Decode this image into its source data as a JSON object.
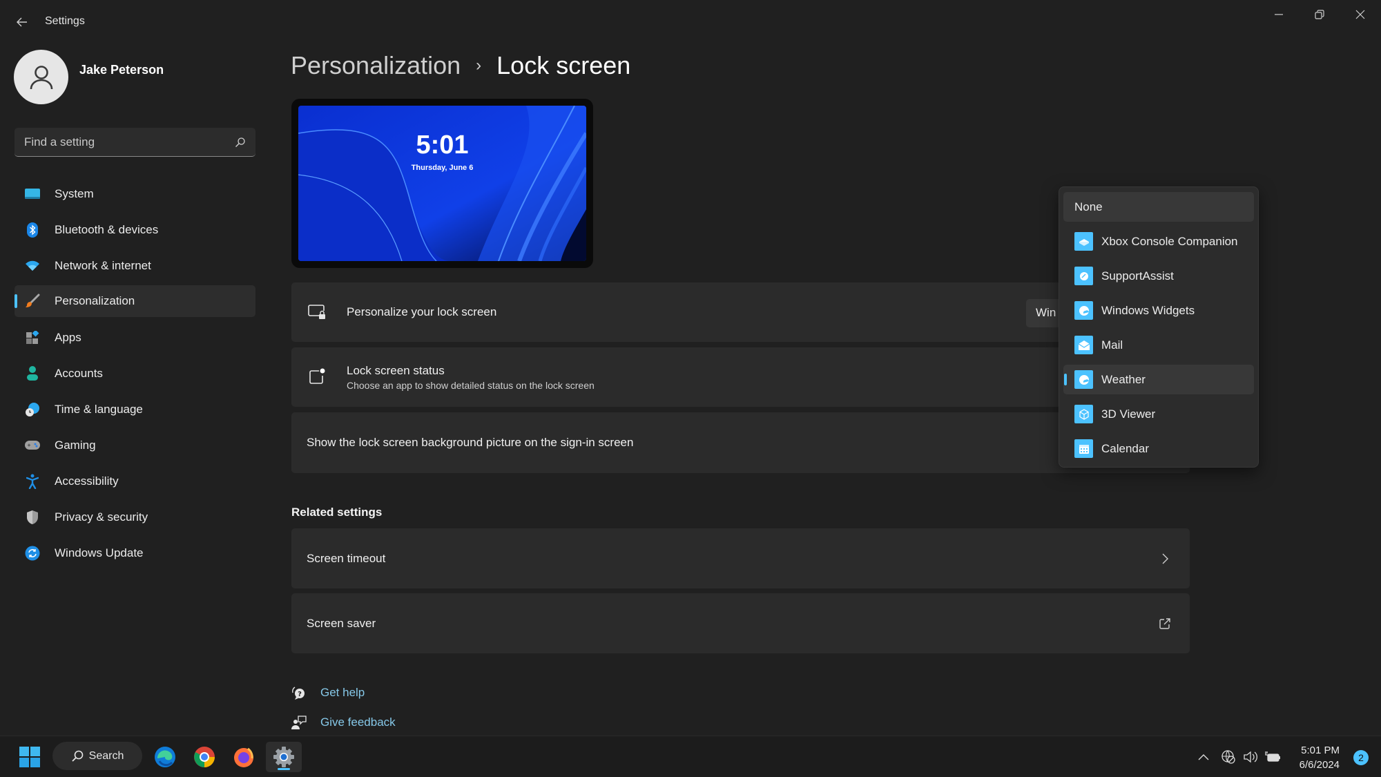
{
  "window": {
    "title": "Settings",
    "controls": [
      "minimize",
      "restore",
      "close"
    ]
  },
  "profile": {
    "name": "Jake Peterson"
  },
  "search": {
    "placeholder": "Find a setting",
    "value": ""
  },
  "sidebar": {
    "selected": "Personalization",
    "items": [
      {
        "label": "System",
        "icon": "monitor-icon"
      },
      {
        "label": "Bluetooth & devices",
        "icon": "bluetooth-icon"
      },
      {
        "label": "Network & internet",
        "icon": "wifi-icon"
      },
      {
        "label": "Personalization",
        "icon": "paintbrush-icon"
      },
      {
        "label": "Apps",
        "icon": "apps-icon"
      },
      {
        "label": "Accounts",
        "icon": "person-icon"
      },
      {
        "label": "Time & language",
        "icon": "globe-clock-icon"
      },
      {
        "label": "Gaming",
        "icon": "gamepad-icon"
      },
      {
        "label": "Accessibility",
        "icon": "accessibility-icon"
      },
      {
        "label": "Privacy & security",
        "icon": "shield-icon"
      },
      {
        "label": "Windows Update",
        "icon": "update-icon"
      }
    ]
  },
  "breadcrumb": {
    "parent": "Personalization",
    "separator": "›",
    "current": "Lock screen"
  },
  "preview": {
    "time": "5:01",
    "date": "Thursday, June 6"
  },
  "cards": {
    "personalize": {
      "title": "Personalize your lock screen",
      "value_truncated": "Win"
    },
    "status": {
      "title": "Lock screen status",
      "subtitle": "Choose an app to show detailed status on the lock screen"
    },
    "signin": {
      "title": "Show the lock screen background picture on the sign-in screen"
    }
  },
  "related": {
    "heading": "Related settings",
    "items": [
      {
        "label": "Screen timeout",
        "icon": "chevron-right-icon"
      },
      {
        "label": "Screen saver",
        "icon": "open-external-icon"
      }
    ]
  },
  "help": {
    "get_help": "Get help",
    "give_feedback": "Give feedback"
  },
  "dropdown": {
    "hovered": "None",
    "selected": "Weather",
    "options": [
      {
        "label": "None",
        "icon": null
      },
      {
        "label": "Xbox Console Companion",
        "icon": "xbox-console-icon"
      },
      {
        "label": "SupportAssist",
        "icon": "supportassist-icon"
      },
      {
        "label": "Windows Widgets",
        "icon": "widgets-icon"
      },
      {
        "label": "Mail",
        "icon": "mail-icon"
      },
      {
        "label": "Weather",
        "icon": "weather-icon"
      },
      {
        "label": "3D Viewer",
        "icon": "cube-icon"
      },
      {
        "label": "Calendar",
        "icon": "calendar-icon"
      }
    ]
  },
  "taskbar": {
    "search_label": "Search",
    "apps": [
      "Edge",
      "Chrome",
      "Firefox",
      "Settings"
    ],
    "active_app": "Settings",
    "clock_time": "5:01 PM",
    "clock_date": "6/6/2024",
    "notification_count": "2"
  },
  "colors": {
    "accent": "#4cc2ff",
    "background": "#202020",
    "card": "#2b2b2b",
    "link": "#86c8e8"
  }
}
